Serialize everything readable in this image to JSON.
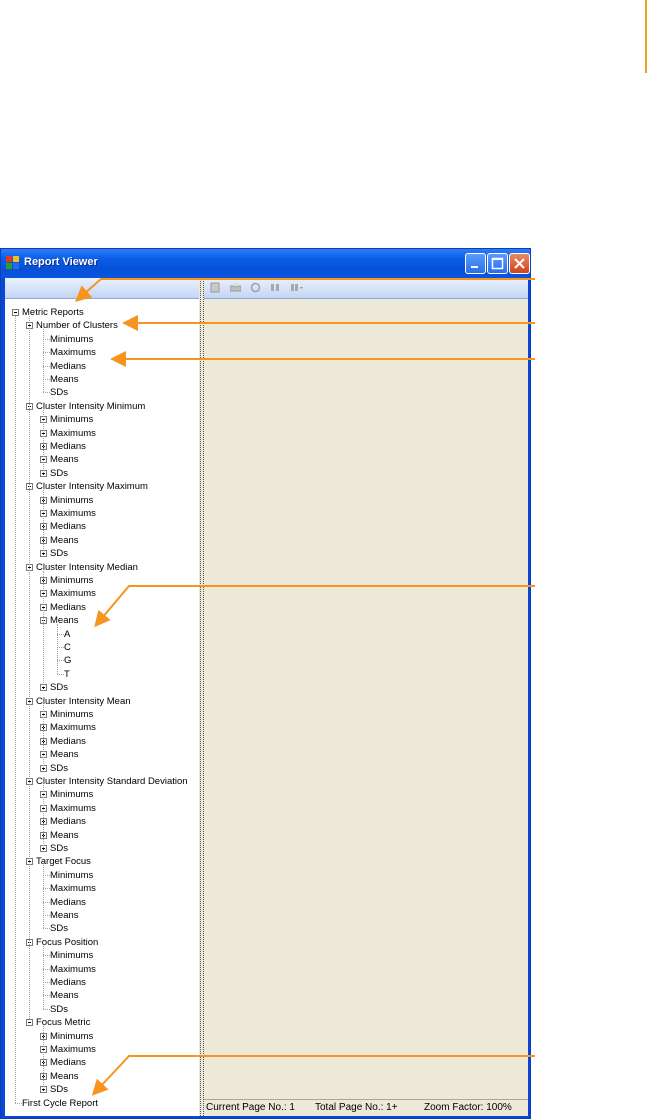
{
  "window": {
    "title": "Report Viewer"
  },
  "toolbar": {
    "icons": [
      "export-icon",
      "print-icon",
      "refresh-icon",
      "find-icon",
      "zoom-icon"
    ]
  },
  "status": {
    "current_page": "Current Page No.: 1",
    "total_page": "Total Page No.: 1+",
    "zoom": "Zoom Factor: 100%"
  },
  "tree": {
    "root": "Metric Reports",
    "groups": [
      {
        "label": "Number of Clusters",
        "children": [
          "Minimums",
          "Maximums",
          "Medians",
          "Means",
          "SDs"
        ],
        "leaf_children": true
      },
      {
        "label": "Cluster Intensity Minimum",
        "children": [
          "Minimums",
          "Maximums",
          "Medians",
          "Means",
          "SDs"
        ],
        "leaf_children": false
      },
      {
        "label": "Cluster Intensity Maximum",
        "children": [
          "Minimums",
          "Maximums",
          "Medians",
          "Means",
          "SDs"
        ],
        "leaf_children": false
      },
      {
        "label": "Cluster Intensity Median",
        "children": [
          "Minimums",
          "Maximums",
          "Medians",
          "Means",
          "SDs"
        ],
        "leaf_children": false,
        "expanded_child": "Means",
        "sub": [
          "A",
          "C",
          "G",
          "T"
        ]
      },
      {
        "label": "Cluster Intensity Mean",
        "children": [
          "Minimums",
          "Maximums",
          "Medians",
          "Means",
          "SDs"
        ],
        "leaf_children": false
      },
      {
        "label": "Cluster Intensity Standard Deviation",
        "children": [
          "Minimums",
          "Maximums",
          "Medians",
          "Means",
          "SDs"
        ],
        "leaf_children": false
      },
      {
        "label": "Target Focus",
        "children": [
          "Minimums",
          "Maximums",
          "Medians",
          "Means",
          "SDs"
        ],
        "leaf_children": true
      },
      {
        "label": "Focus Position",
        "children": [
          "Minimums",
          "Maximums",
          "Medians",
          "Means",
          "SDs"
        ],
        "leaf_children": true
      },
      {
        "label": "Focus Metric",
        "children": [
          "Minimums",
          "Maximums",
          "Medians",
          "Means",
          "SDs"
        ],
        "leaf_children": false
      }
    ],
    "last": "First Cycle Report"
  },
  "colors": {
    "arrow": "#f7941d",
    "titlebar": "#0a5ce6",
    "viewer_bg": "#ece9d8"
  }
}
